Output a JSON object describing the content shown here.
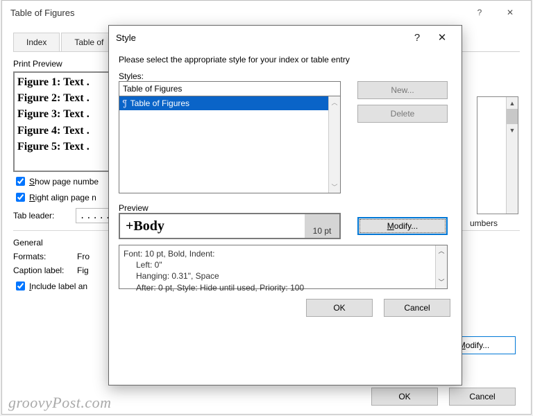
{
  "backDialog": {
    "title": "Table of Figures",
    "tabs": [
      "Index",
      "Table of"
    ],
    "printPreviewLabel": "Print Preview",
    "previewRows": [
      "Figure 1: Text .",
      "Figure 2: Text .",
      "Figure 3: Text .",
      "Figure 4: Text .",
      "Figure 5: Text ."
    ],
    "showPageNumbers": "Show page numbe",
    "rightAlign": "Right align page n",
    "tabLeaderLabel": "Tab leader:",
    "tabLeaderValue": ".......",
    "generalLabel": "General",
    "formatsLabel": "Formats:",
    "formatsValue": "Fro",
    "captionLabel": "Caption label:",
    "captionValue": "Fig",
    "includeLabel": "Include label an",
    "numbersText": "umbers",
    "modify": "Modify...",
    "ok": "OK",
    "cancel": "Cancel"
  },
  "frontDialog": {
    "title": "Style",
    "prompt": "Please select the appropriate style for your index or table entry",
    "stylesLabel": "Styles:",
    "stylesInput": "Table of Figures",
    "stylesItem": "Table of Figures",
    "newBtn": "New...",
    "deleteBtn": "Delete",
    "previewLabel": "Preview",
    "previewBody": "+Body",
    "previewPt": "10 pt",
    "modify": "Modify...",
    "descLine1": "Font: 10 pt, Bold, Indent:",
    "descLine2": "Left:  0\"",
    "descLine3": "Hanging:  0.31\", Space",
    "descLine4": "After:  0 pt, Style: Hide until used, Priority: 100",
    "ok": "OK",
    "cancel": "Cancel"
  },
  "watermark": "groovyPost.com"
}
